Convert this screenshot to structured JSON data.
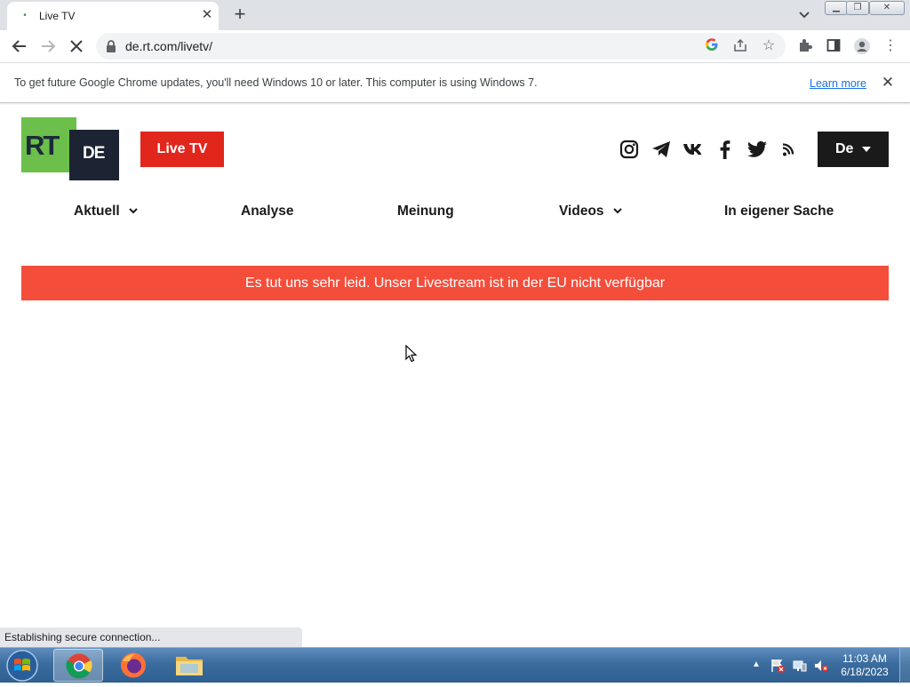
{
  "browser": {
    "tab_title": "Live TV",
    "url": "de.rt.com/livetv/",
    "infobar_text": "To get future Google Chrome updates, you'll need Windows 10 or later. This computer is using Windows 7.",
    "infobar_link": "Learn more",
    "status_text": "Establishing secure connection..."
  },
  "site": {
    "logo_rt": "RT",
    "logo_de": "DE",
    "live_tv_label": "Live TV",
    "language_label": "De",
    "social_icons": [
      "instagram-icon",
      "telegram-icon",
      "vk-icon",
      "facebook-icon",
      "twitter-icon",
      "rss-icon"
    ],
    "nav": {
      "aktuell": "Aktuell",
      "analyse": "Analyse",
      "meinung": "Meinung",
      "videos": "Videos",
      "eigene": "In eigener Sache"
    },
    "notice": "Es tut uns sehr leid. Unser Livestream ist in der EU nicht verfügbar"
  },
  "taskbar": {
    "time": "11:03 AM",
    "date": "6/18/2023"
  },
  "colors": {
    "brand_red": "#e1261c",
    "notice_red": "#f44e3b",
    "rt_green": "#6bbf4a",
    "rt_navy": "#1c2433"
  }
}
